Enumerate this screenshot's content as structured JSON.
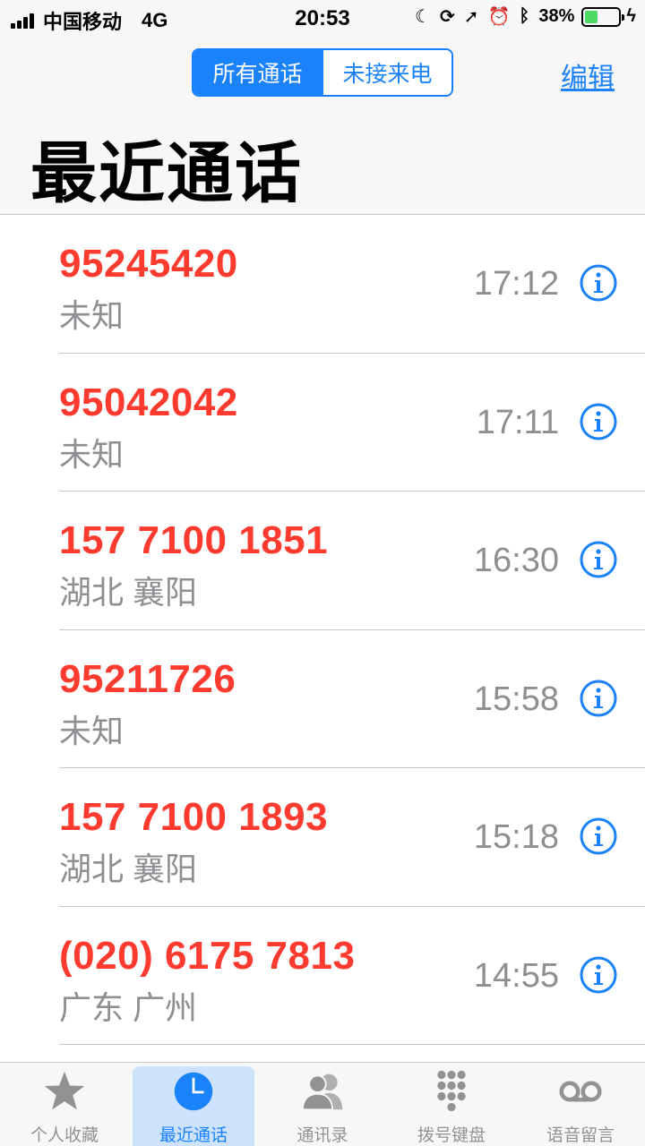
{
  "status": {
    "carrier": "中国移动",
    "network": "4G",
    "time": "20:53",
    "battery": "38%",
    "battery_level": 0.38,
    "icons": [
      "moon-icon",
      "orientation-lock-icon",
      "location-icon",
      "alarm-icon",
      "bluetooth-icon",
      "charging-icon"
    ]
  },
  "header": {
    "segments": [
      "所有通话",
      "未接来电"
    ],
    "active_segment": 0,
    "edit": "编辑",
    "title": "最近通话"
  },
  "calls": [
    {
      "number": "95245420",
      "location": "未知",
      "time": "17:12"
    },
    {
      "number": "95042042",
      "location": "未知",
      "time": "17:11"
    },
    {
      "number": "157 7100 1851",
      "location": "湖北 襄阳",
      "time": "16:30"
    },
    {
      "number": "95211726",
      "location": "未知",
      "time": "15:58"
    },
    {
      "number": "157 7100 1893",
      "location": "湖北 襄阳",
      "time": "15:18"
    },
    {
      "number": "(020) 6175 7813",
      "location": "广东 广州",
      "time": "14:55"
    }
  ],
  "tabs": [
    {
      "label": "个人收藏",
      "icon": "star-icon"
    },
    {
      "label": "最近通话",
      "icon": "clock-icon"
    },
    {
      "label": "通讯录",
      "icon": "contacts-icon"
    },
    {
      "label": "拨号键盘",
      "icon": "keypad-icon"
    },
    {
      "label": "语音留言",
      "icon": "voicemail-icon"
    }
  ],
  "colors": {
    "accent": "#1a82fb",
    "missed": "#ff3b30",
    "secondary": "#8e8e93",
    "battery": "#4cd964"
  }
}
